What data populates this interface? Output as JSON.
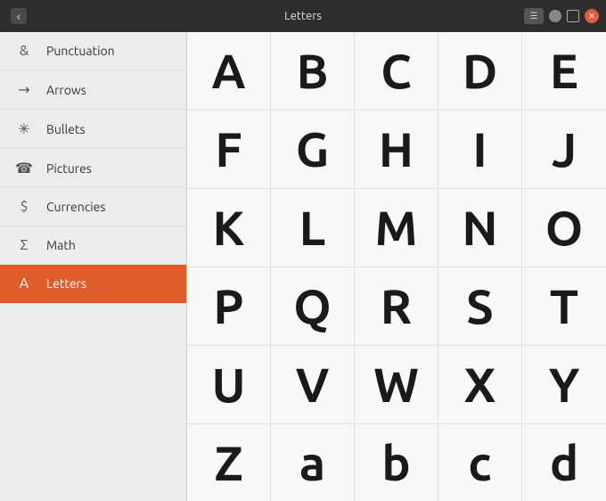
{
  "titlebar": {
    "title": "Letters",
    "back_icon": "‹",
    "menu_icon": "☰",
    "close_icon": "✕"
  },
  "sidebar": {
    "items": [
      {
        "id": "punctuation",
        "label": "Punctuation",
        "icon": "&",
        "icon_type": "ampersand",
        "active": false
      },
      {
        "id": "arrows",
        "label": "Arrows",
        "icon": "→",
        "icon_type": "arrow",
        "active": false
      },
      {
        "id": "bullets",
        "label": "Bullets",
        "icon": "✳",
        "icon_type": "asterisk",
        "active": false
      },
      {
        "id": "pictures",
        "label": "Pictures",
        "icon": "☎",
        "icon_type": "phone",
        "active": false
      },
      {
        "id": "currencies",
        "label": "Currencies",
        "icon": "$",
        "icon_type": "dollar",
        "active": false
      },
      {
        "id": "math",
        "label": "Math",
        "icon": "Σ",
        "icon_type": "sigma",
        "active": false
      },
      {
        "id": "letters",
        "label": "Letters",
        "icon": "A",
        "icon_type": "letter-a",
        "active": true
      }
    ]
  },
  "chars": {
    "rows": [
      [
        "A",
        "B",
        "C",
        "D",
        "E"
      ],
      [
        "F",
        "G",
        "H",
        "I",
        "J"
      ],
      [
        "K",
        "L",
        "M",
        "N",
        "O"
      ],
      [
        "P",
        "Q",
        "R",
        "S",
        "T"
      ],
      [
        "U",
        "V",
        "W",
        "X",
        "Y"
      ],
      [
        "Z",
        "a",
        "b",
        "c",
        "d"
      ]
    ]
  },
  "colors": {
    "active_bg": "#e05c2a",
    "titlebar_bg": "#2d2d2d",
    "sidebar_bg": "#ececec",
    "close_btn": "#e05c42"
  }
}
